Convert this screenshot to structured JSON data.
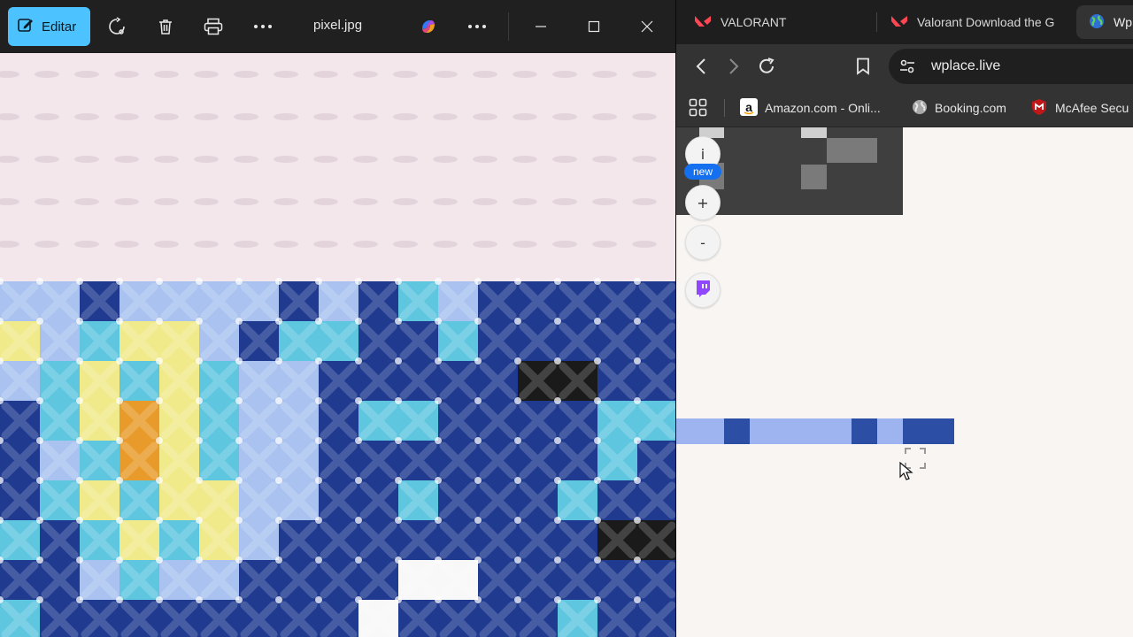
{
  "viewer": {
    "edit_label": "Editar",
    "filename": "pixel.jpg"
  },
  "browser": {
    "tabs": [
      {
        "title": "VALORANT",
        "icon": "valorant-icon"
      },
      {
        "title": "Valorant Download the G",
        "icon": "valorant-icon"
      },
      {
        "title": "Wp",
        "icon": "globe-icon"
      }
    ],
    "url": "wplace.live",
    "bookmarks": [
      {
        "title": "Amazon.com - Onli...",
        "icon": "amazon-icon"
      },
      {
        "title": "Booking.com",
        "icon": "globe-icon"
      },
      {
        "title": "McAfee Secu",
        "icon": "mcafee-icon"
      }
    ]
  },
  "wplace": {
    "info_label": "i",
    "new_badge": "new",
    "zoom_in_label": "+",
    "zoom_out_label": "-"
  },
  "colors": {
    "edit_accent": "#4cc2ff",
    "badge_blue": "#1570ef",
    "pixel_light_blue": "#9eb4f0",
    "pixel_dark_blue": "#2c4fa5",
    "twitch_purple": "#9146ff"
  }
}
